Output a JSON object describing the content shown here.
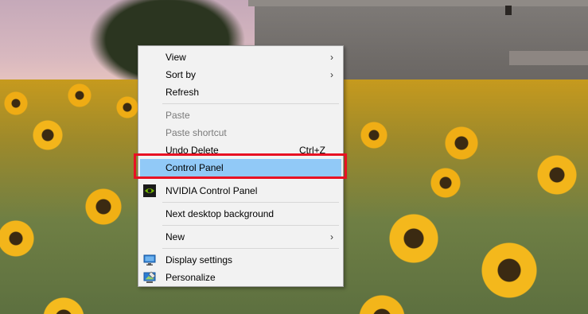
{
  "context_menu": {
    "items": [
      {
        "label": "View",
        "submenu": true
      },
      {
        "label": "Sort by",
        "submenu": true
      },
      {
        "label": "Refresh"
      },
      {
        "label": "Paste",
        "disabled": true
      },
      {
        "label": "Paste shortcut",
        "disabled": true
      },
      {
        "label": "Undo Delete",
        "shortcut": "Ctrl+Z"
      },
      {
        "label": "Control Panel",
        "highlighted": true
      },
      {
        "label": "NVIDIA Control Panel",
        "icon": "nvidia-icon"
      },
      {
        "label": "Next desktop background"
      },
      {
        "label": "New",
        "submenu": true
      },
      {
        "label": "Display settings",
        "icon": "display-settings-icon"
      },
      {
        "label": "Personalize",
        "icon": "personalize-icon"
      }
    ],
    "submenu_arrow": "›"
  },
  "colors": {
    "highlight": "#91c9f7",
    "annotation_frame": "#e81123"
  }
}
